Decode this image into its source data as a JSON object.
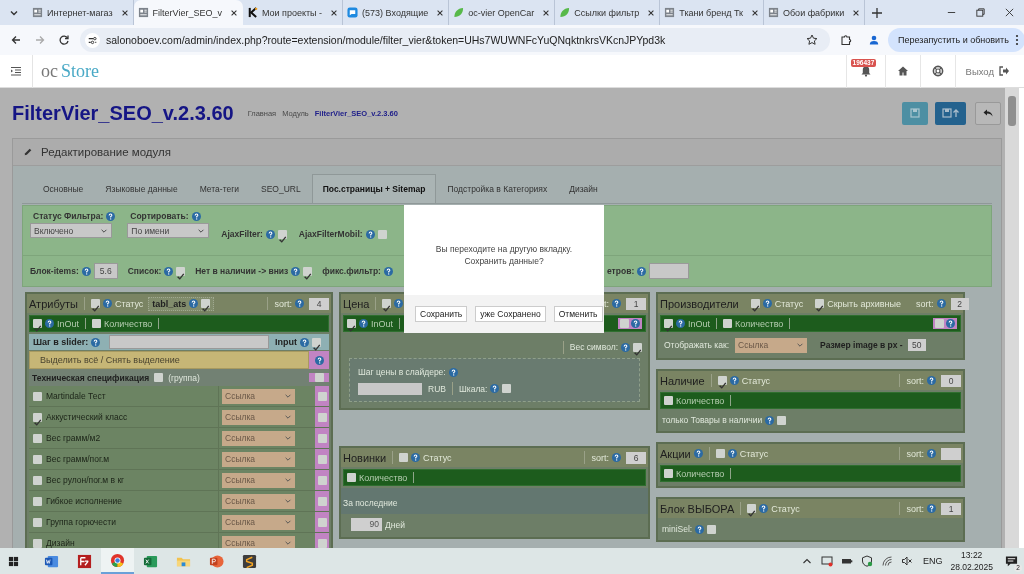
{
  "browser": {
    "tabs": [
      {
        "kind": "site",
        "title": "Интернет-магаз",
        "selected": false
      },
      {
        "kind": "site",
        "title": "FilterVier_SEO_v",
        "selected": true
      },
      {
        "kind": "k",
        "title": "Мои проекты -",
        "selected": false
      },
      {
        "kind": "mail",
        "title": "(573) Входящие",
        "selected": false
      },
      {
        "kind": "leaf",
        "title": "oc-vier OpenCar",
        "selected": false
      },
      {
        "kind": "leaf",
        "title": "Ссылки фильтр",
        "selected": false
      },
      {
        "kind": "site",
        "title": "Ткани бренд Тк",
        "selected": false
      },
      {
        "kind": "site",
        "title": "Обои фабрики",
        "selected": false
      }
    ],
    "url": "salonoboev.com/admin/index.php?route=extension/module/filter_vier&token=UHs7WUWNFcYuQNqktnkrsVKcnJPYpd3k",
    "update_button": "Перезапустить и обновить"
  },
  "header": {
    "logo_prefix": "oc",
    "logo_name": "Store",
    "notifications": "196437",
    "logout": "Выход"
  },
  "page": {
    "title": "FilterVier_SEO_v.2.3.60",
    "breadcrumbs": [
      {
        "label": "Главная",
        "current": false
      },
      {
        "label": "Модуль",
        "current": false
      },
      {
        "label": "FilterVier_SEO_v.2.3.60",
        "current": true
      }
    ]
  },
  "panel": {
    "heading": "Редактирование модуля",
    "tabs": [
      {
        "label": "Основные",
        "selected": false
      },
      {
        "label": "Языковые данные",
        "selected": false
      },
      {
        "label": "Мета-теги",
        "selected": false
      },
      {
        "label": "SEO_URL",
        "selected": false
      },
      {
        "label": "Пос.страницы + Sitemap",
        "selected": true
      },
      {
        "label": "Подстройка в Категориях",
        "selected": false
      },
      {
        "label": "Дизайн",
        "selected": false
      }
    ]
  },
  "settings": {
    "row_1": [
      {
        "kind": "select",
        "label": "Статус Фильтра:",
        "value": "Включено"
      },
      {
        "kind": "select",
        "label": "Сортировать:",
        "value": "По имени"
      },
      {
        "kind": "check",
        "label": "AjaxFilter:",
        "checked": true
      },
      {
        "kind": "check",
        "label": "AjaxFilterMobil:",
        "checked": false
      }
    ],
    "row_2": [
      {
        "kind": "field",
        "label": "Блок-items:",
        "value": "5.6"
      },
      {
        "kind": "check",
        "label": "Список:",
        "checked": true
      },
      {
        "kind": "check",
        "label": "Нет в наличии -> вниз",
        "checked": true
      },
      {
        "kind": "label",
        "label": "фикс.фильтр:"
      }
    ],
    "row_2_end": [
      {
        "kind": "field",
        "label": "етров:"
      }
    ]
  },
  "columns": [
    [
      {
        "title": "Атрибуты",
        "status": {
          "checked": true,
          "help": true,
          "label": "Статус"
        },
        "extra": {
          "kind": "table",
          "label": "tabl_ats",
          "help": true,
          "checked": true
        },
        "sort_label": "sort:",
        "sort": "4",
        "lines": [
          {
            "kind": "bar",
            "checks": [
              {
                "label": "InOut",
                "checked": true,
                "help": true
              },
              {
                "label": "Количество",
                "checked": false
              }
            ]
          },
          {
            "kind": "step",
            "label": "Шаг в slider:",
            "input_label": "Input",
            "input_checked": true
          },
          {
            "kind": "select_all",
            "label": "Выделить всё / Снять выделение"
          },
          {
            "kind": "group",
            "name": "Техническая спецификация",
            "label": "(группа)",
            "checked": false,
            "flag": false
          },
          {
            "kind": "attr",
            "name": "Martindale Тест",
            "checked": false,
            "display": "Ссылка",
            "flag": false
          },
          {
            "kind": "attr",
            "name": "Аккустический класс",
            "checked": true,
            "display": "Ссылка",
            "flag": false
          },
          {
            "kind": "attr",
            "name": "Вес грамм/м2",
            "checked": false,
            "display": "Ссылка",
            "flag": false
          },
          {
            "kind": "attr",
            "name": "Вес грамм/пог.м",
            "checked": false,
            "display": "Ссылка",
            "flag": false
          },
          {
            "kind": "attr",
            "name": "Вес рулон/пог.м в кг",
            "checked": false,
            "display": "Ссылка",
            "flag": false
          },
          {
            "kind": "attr",
            "name": "Гибкое исполнение",
            "checked": false,
            "display": "Ссылка",
            "flag": false
          },
          {
            "kind": "attr",
            "name": "Группа горючести",
            "checked": false,
            "display": "Ссылка",
            "flag": false
          },
          {
            "kind": "attr",
            "name": "Дизайн",
            "checked": false,
            "display": "Ссылка",
            "flag": false
          }
        ]
      }
    ],
    [
      {
        "title": "Цена",
        "status": {
          "checked": true,
          "help": true
        },
        "sort_label": "t:",
        "sort": "1",
        "lines": [
          {
            "kind": "bar",
            "checks": [
              {
                "label": "InOut",
                "checked": true,
                "help": true
              }
            ],
            "flag": {
              "checked": false
            }
          },
          {
            "kind": "symbol",
            "label": "Вес символ:",
            "checked": true
          },
          {
            "kind": "price_step",
            "label": "Шаг цены в слайдере:",
            "currency": "RUB",
            "scale_label": "Шкала:",
            "scale_checked": false
          }
        ]
      },
      {
        "title": "Новинки",
        "status": {
          "checked": false,
          "help": true,
          "label": "Статус"
        },
        "sort_label": "sort:",
        "sort": "6",
        "lines": [
          {
            "kind": "bar",
            "checks": [
              {
                "label": "Количество",
                "checked": false
              }
            ]
          },
          {
            "kind": "period",
            "label": "За последние",
            "days": "90",
            "unit": "Дней"
          }
        ]
      }
    ],
    [
      {
        "title": "Производители",
        "status": {
          "checked": true,
          "help": true,
          "label": "Статус"
        },
        "extra": {
          "kind": "plain",
          "label": "Скрыть архивные",
          "checked": true
        },
        "sort_label": "sort:",
        "sort": "2",
        "lines": [
          {
            "kind": "bar",
            "checks": [
              {
                "label": "InOut",
                "checked": true,
                "help": true
              },
              {
                "label": "Количество",
                "checked": false
              }
            ],
            "flag": {
              "checked": false
            }
          },
          {
            "kind": "options",
            "label": "Отображать как:",
            "display": "Ссылка",
            "size_label": "Размер image в px -",
            "size": "50"
          }
        ]
      },
      {
        "title": "Наличие",
        "status": {
          "checked": true,
          "help": true,
          "label": "Статус"
        },
        "sort_label": "sort:",
        "sort": "0",
        "lines": [
          {
            "kind": "bar",
            "checks": [
              {
                "label": "Количество",
                "checked": false
              }
            ]
          },
          {
            "kind": "toggle",
            "label": "только Товары в наличии",
            "checked": false
          }
        ]
      },
      {
        "title": "Акции",
        "title_help": true,
        "status": {
          "checked": false,
          "help": true,
          "label": "Статус"
        },
        "sort_label": "sort:",
        "lines": [
          {
            "kind": "bar",
            "checks": [
              {
                "label": "Количество",
                "checked": false
              }
            ]
          }
        ]
      },
      {
        "title": "Блок ВЫБОРА",
        "status": {
          "checked": true,
          "help": true,
          "label": "Статус"
        },
        "sort_label": "sort:",
        "sort": "1",
        "lines": [
          {
            "kind": "toggle",
            "label": "miniSel:",
            "checked": false
          }
        ]
      }
    ]
  ],
  "dialog": {
    "message_lines": [
      "Вы переходите на другую вкладку.",
      "Сохранить данные?"
    ],
    "buttons": [
      "Сохранить",
      "уже Сохранено",
      "Отменить"
    ]
  },
  "taskbar": {
    "apps": [
      {
        "kind": "document",
        "selected": false
      },
      {
        "kind": "ftp",
        "selected": false
      },
      {
        "kind": "browser",
        "selected": true
      },
      {
        "kind": "spreadsheet",
        "selected": false
      },
      {
        "kind": "folder",
        "selected": false
      },
      {
        "kind": "presentation",
        "selected": false
      },
      {
        "kind": "editor",
        "selected": false
      }
    ],
    "language": "ENG",
    "time": "13:22",
    "date": "28.02.2025",
    "notifications": "2"
  }
}
